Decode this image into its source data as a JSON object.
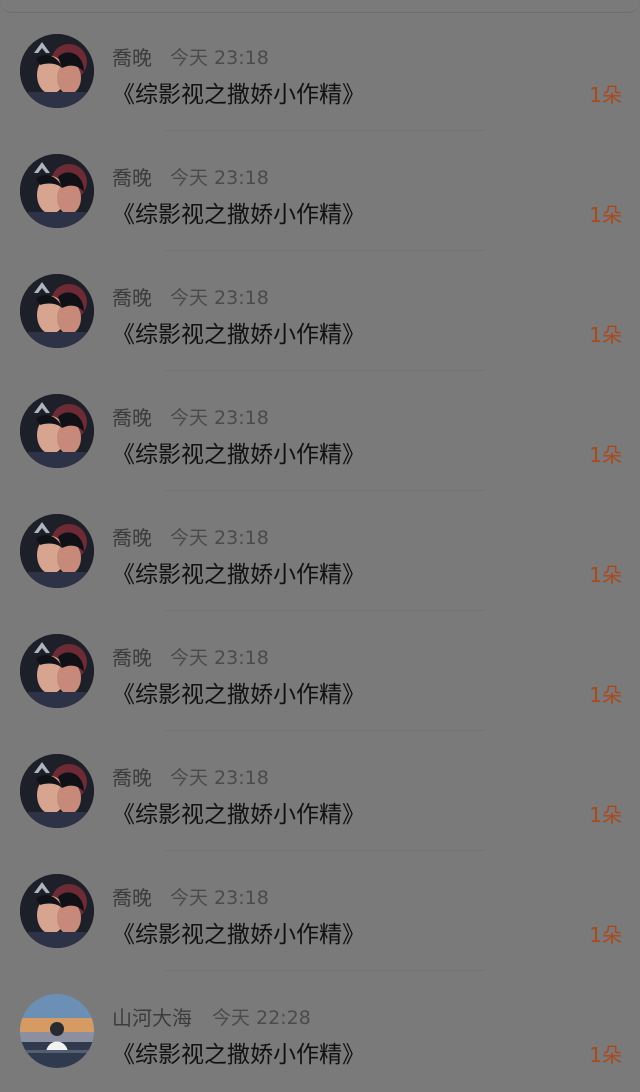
{
  "gifts": [
    {
      "user": "喬晚",
      "time": "今天 23:18",
      "title": "《综影视之撒娇小作精》",
      "amount": "1朵",
      "avatar": "dark-portrait-avatar"
    },
    {
      "user": "喬晚",
      "time": "今天 23:18",
      "title": "《综影视之撒娇小作精》",
      "amount": "1朵",
      "avatar": "dark-portrait-avatar"
    },
    {
      "user": "喬晚",
      "time": "今天 23:18",
      "title": "《综影视之撒娇小作精》",
      "amount": "1朵",
      "avatar": "dark-portrait-avatar"
    },
    {
      "user": "喬晚",
      "time": "今天 23:18",
      "title": "《综影视之撒娇小作精》",
      "amount": "1朵",
      "avatar": "dark-portrait-avatar"
    },
    {
      "user": "喬晚",
      "time": "今天 23:18",
      "title": "《综影视之撒娇小作精》",
      "amount": "1朵",
      "avatar": "dark-portrait-avatar"
    },
    {
      "user": "喬晚",
      "time": "今天 23:18",
      "title": "《综影视之撒娇小作精》",
      "amount": "1朵",
      "avatar": "dark-portrait-avatar"
    },
    {
      "user": "喬晚",
      "time": "今天 23:18",
      "title": "《综影视之撒娇小作精》",
      "amount": "1朵",
      "avatar": "dark-portrait-avatar"
    },
    {
      "user": "喬晚",
      "time": "今天 23:18",
      "title": "《综影视之撒娇小作精》",
      "amount": "1朵",
      "avatar": "dark-portrait-avatar"
    },
    {
      "user": "山河大海",
      "time": "今天 22:28",
      "title": "《综影视之撒娇小作精》",
      "amount": "1朵",
      "avatar": "sunset-sea-avatar"
    }
  ],
  "colors": {
    "overlay_background": "#7a7a7a",
    "amount_accent": "#a9481c"
  }
}
